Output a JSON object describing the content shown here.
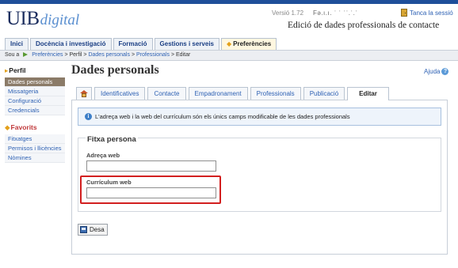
{
  "header": {
    "logo_main": "UIB",
    "logo_sub": "digital",
    "version": "Versió 1.72",
    "username": "Fə.ı.ı. ˈ ˈ ˈˈ.ˈ.ˈ",
    "logout": "Tanca la sessió",
    "app_title": "Edició de dades professionals de contacte"
  },
  "main_nav": [
    {
      "label": "Inici"
    },
    {
      "label": "Docència i investigació"
    },
    {
      "label": "Formació"
    },
    {
      "label": "Gestions i serveis"
    },
    {
      "label": "Preferències",
      "active": true
    }
  ],
  "breadcrumb": {
    "prefix": "Sou a",
    "items": [
      "Preferències",
      "Perfil",
      "Dades personals",
      "Professionals",
      "Editar"
    ],
    "separator": ">"
  },
  "sidebar": {
    "perfil_title": "Perfil",
    "perfil_items": [
      {
        "label": "Dades personals",
        "active": true
      },
      {
        "label": "Missatgeria"
      },
      {
        "label": "Configuració"
      },
      {
        "label": "Credencials"
      }
    ],
    "favorits_title": "Favorits",
    "favorits_items": [
      {
        "label": "Fitxatges"
      },
      {
        "label": "Permisos i llicències"
      },
      {
        "label": "Nòmines"
      }
    ]
  },
  "page": {
    "title": "Dades personals",
    "help": "Ajuda"
  },
  "sub_tabs": [
    {
      "label": "",
      "icon": "home-icon"
    },
    {
      "label": "Identificatives"
    },
    {
      "label": "Contacte"
    },
    {
      "label": "Empadronament"
    },
    {
      "label": "Professionals"
    },
    {
      "label": "Publicació"
    },
    {
      "label": "Editar",
      "active": true
    }
  ],
  "info": {
    "text": "L'adreça web i la web del currículum són els únics camps modificable de les dades professionals"
  },
  "form": {
    "legend": "Fitxa persona",
    "web_label": "Adreça web",
    "web_value": "",
    "cv_label": "Currículum web",
    "cv_value": "",
    "save_label": "Desa"
  },
  "colors": {
    "accent": "#1f4f9a",
    "link": "#2f62b4",
    "highlight": "#d21f1f",
    "active_sidebar": "#8b7b68"
  }
}
